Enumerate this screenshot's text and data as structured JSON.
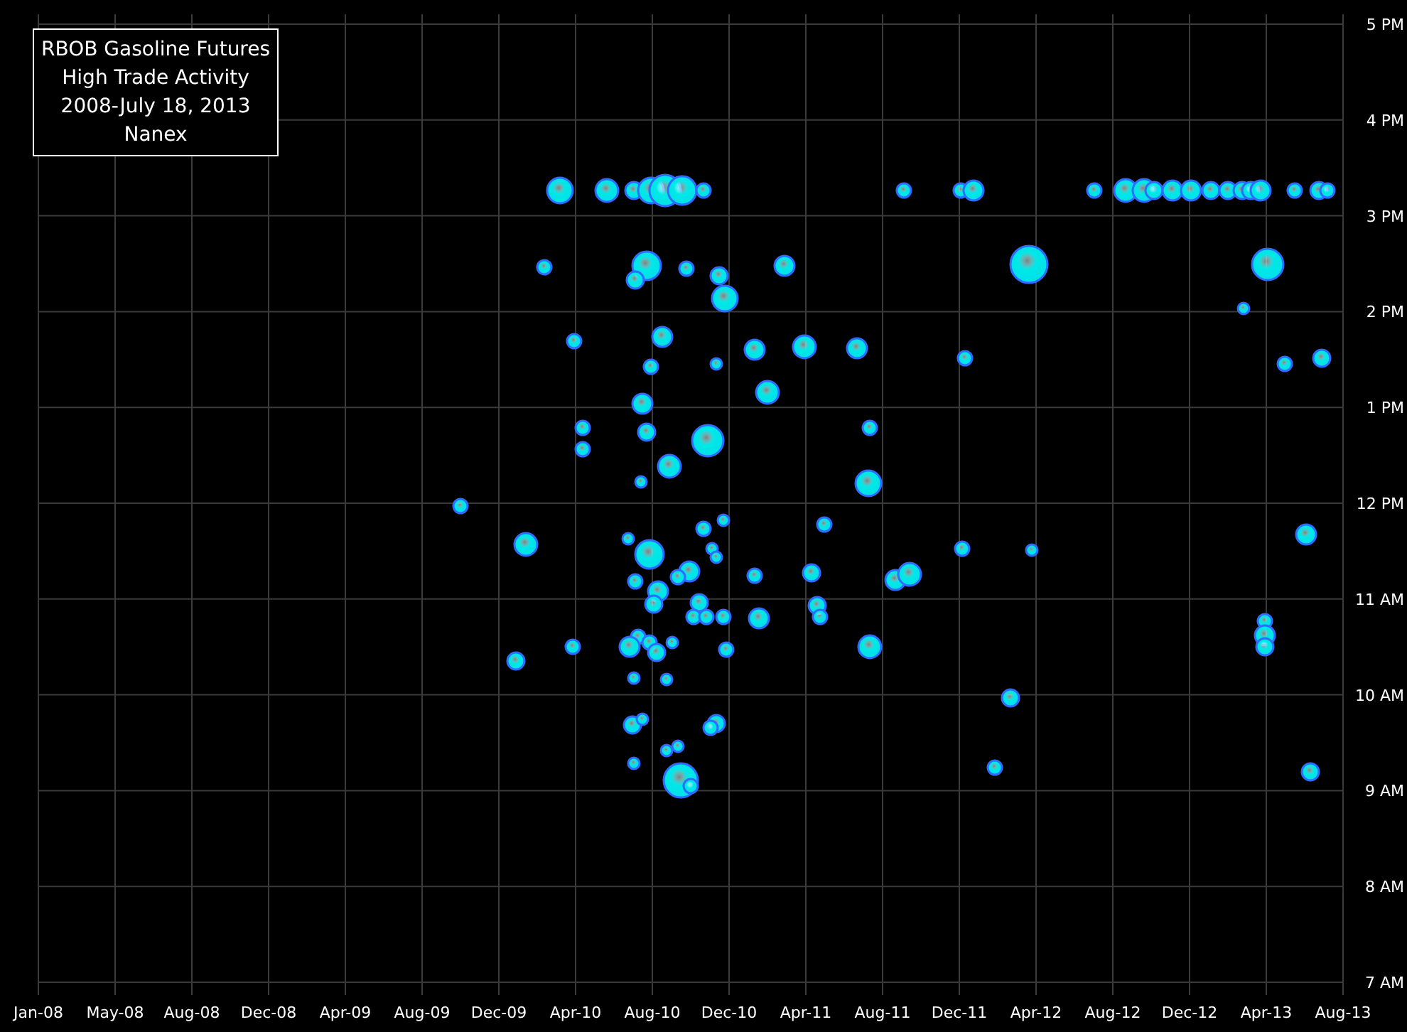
{
  "title_box": {
    "lines": [
      "RBOB Gasoline Futures",
      "High Trade Activity",
      "2008-July 18, 2013",
      "Nanex"
    ]
  },
  "x_axis": {
    "labels": [
      "Jan-08",
      "May-08",
      "Aug-08",
      "Dec-08",
      "Apr-09",
      "Aug-09",
      "Dec-09",
      "Apr-10",
      "Aug-10",
      "Dec-10",
      "Apr-11",
      "Aug-11",
      "Dec-11",
      "Apr-12",
      "Aug-12",
      "Dec-12",
      "Apr-13",
      "Aug-13"
    ]
  },
  "y_axis": {
    "labels": [
      "5 PM",
      "4 PM",
      "3 PM",
      "2 PM",
      "1 PM",
      "12 PM",
      "11 AM",
      "10 AM",
      "9 AM",
      "8 AM",
      "7 AM"
    ]
  }
}
